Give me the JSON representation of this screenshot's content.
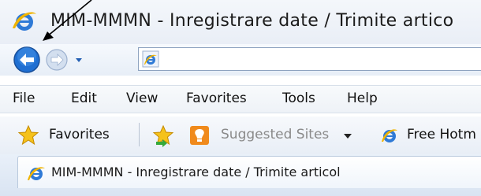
{
  "window": {
    "title": "MIM-MMMN - Inregistrare date / Trimite artico"
  },
  "navigation": {
    "back": "back",
    "forward": "forward",
    "address_value": ""
  },
  "menu": {
    "items": [
      "File",
      "Edit",
      "View",
      "Favorites",
      "Tools",
      "Help"
    ]
  },
  "favorites_bar": {
    "favorites_label": "Favorites",
    "suggested_sites_label": "Suggested Sites",
    "free_hotmail_label": "Free Hotm"
  },
  "tab": {
    "title": "MIM-MMMN - Inregistrare date / Trimite articol"
  },
  "colors": {
    "ie_blue": "#1f6fd2",
    "ie_gold": "#f0b400",
    "suggested_orange": "#f08a1c"
  }
}
